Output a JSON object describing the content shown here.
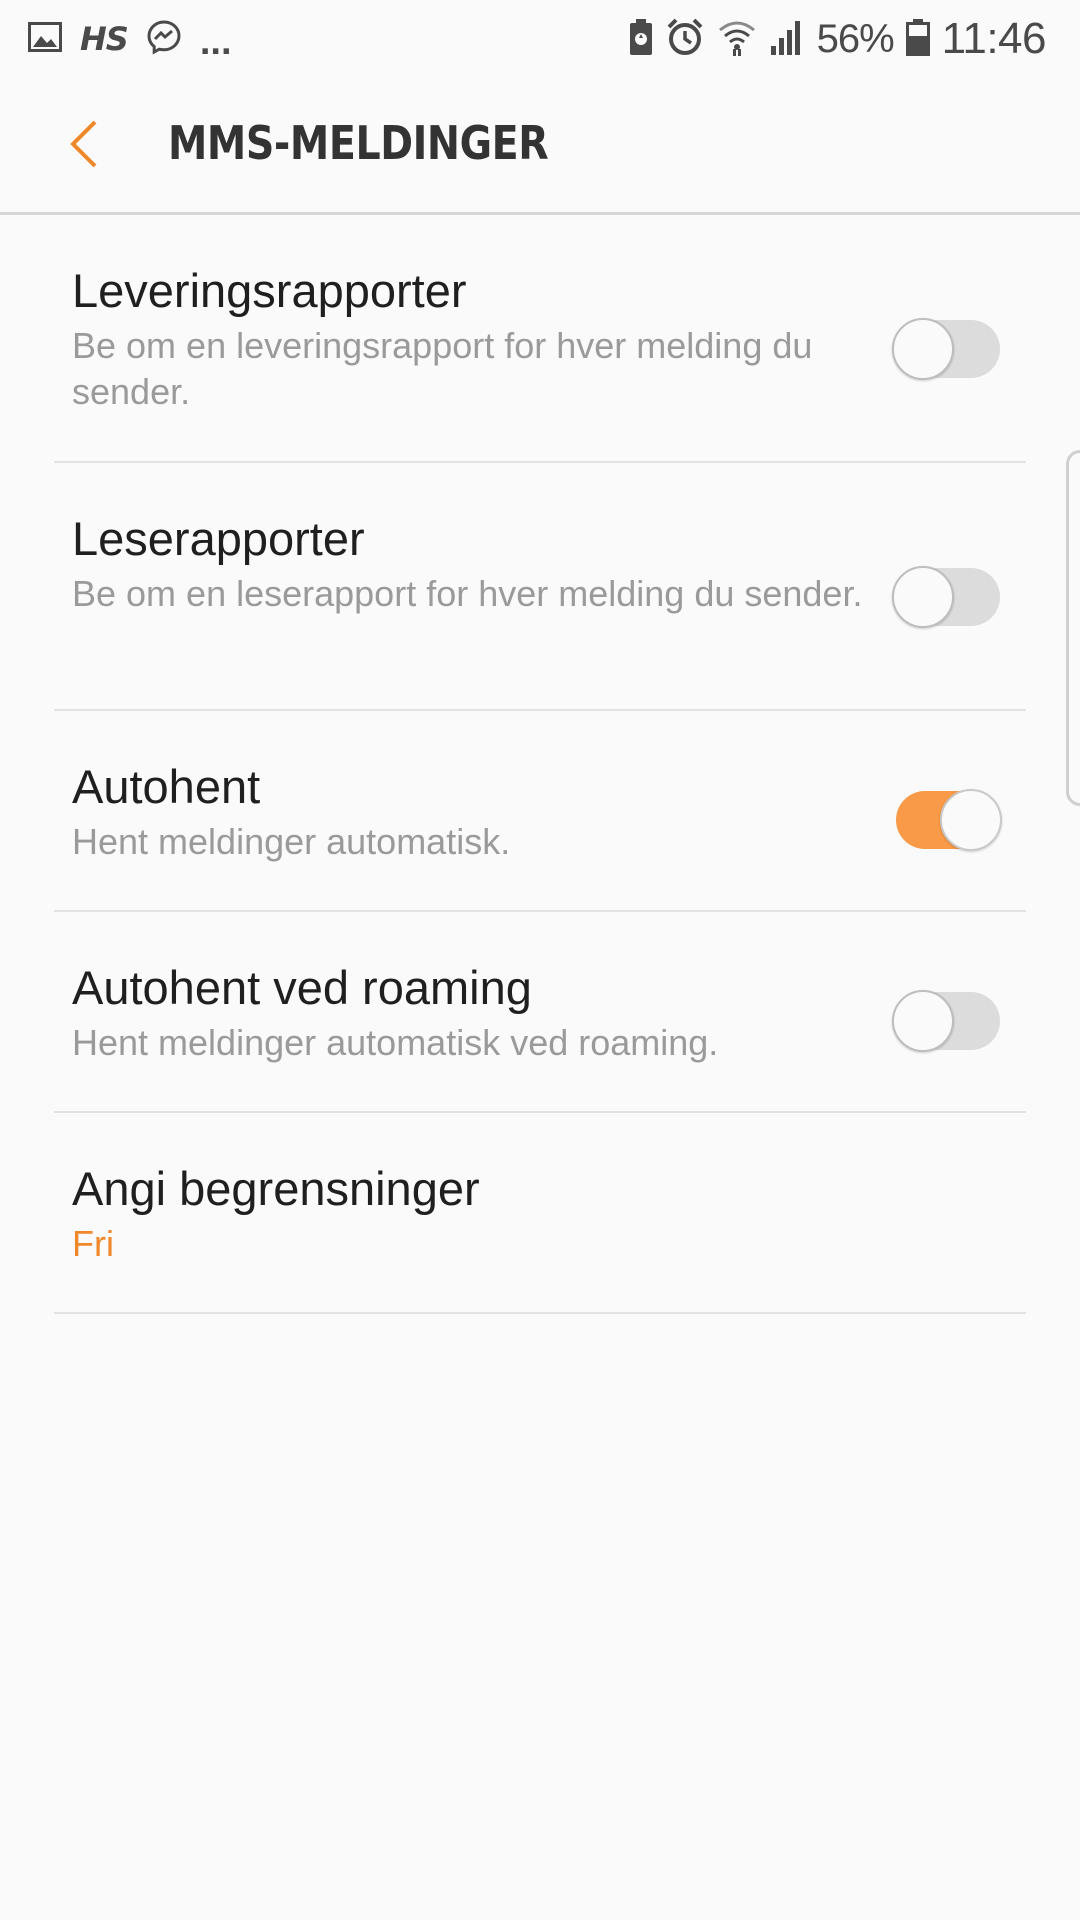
{
  "status_bar": {
    "left_icons": [
      "image-icon",
      "hs-icon",
      "messenger-icon",
      "more-notifications-icon"
    ],
    "hs_label": "HS",
    "more_label": "...",
    "right_icons": [
      "battery-saver-icon",
      "alarm-icon",
      "wifi-icon",
      "signal-icon",
      "battery-icon"
    ],
    "battery_percent": "56%",
    "time": "11:46"
  },
  "header": {
    "title": "MMS-MELDINGER",
    "back_icon": "chevron-left-icon"
  },
  "colors": {
    "accent": "#f0882a",
    "toggle_on": "#f89a47",
    "toggle_off": "#dcdcdc",
    "title_text": "#1f1f1f",
    "summary_text": "#9a9a9a"
  },
  "settings": [
    {
      "title": "Leveringsrapporter",
      "summary": "Be om en leveringsrapport for hver melding du sender.",
      "toggle": false
    },
    {
      "title": "Leserapporter",
      "summary": "Be om en leserapport for hver melding du sender.",
      "toggle": false
    },
    {
      "title": "Autohent",
      "summary": "Hent meldinger automatisk.",
      "toggle": true
    },
    {
      "title": "Autohent ved roaming",
      "summary": "Hent meldinger automatisk ved roaming.",
      "toggle": false
    },
    {
      "title": "Angi begrensninger",
      "summary": "Fri",
      "toggle": null
    }
  ]
}
